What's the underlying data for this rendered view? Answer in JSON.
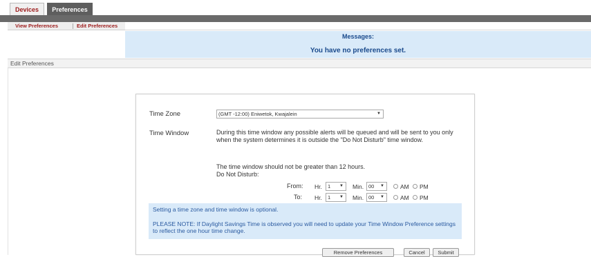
{
  "tabs": {
    "devices": "Devices",
    "preferences": "Preferences"
  },
  "sub_nav": {
    "view": "View Preferences",
    "edit": "Edit Preferences"
  },
  "messages": {
    "title": "Messages:",
    "text": "You have no preferences set."
  },
  "panel": {
    "title": "Edit Preferences"
  },
  "form": {
    "time_zone_label": "Time Zone",
    "time_zone_value": "(GMT -12:00) Eniwetok, Kwajalein",
    "time_window_label": "Time Window",
    "window_desc": "During this time window any possible alerts will be queued and will be sent to you only when the system determines it is outside the \"Do Not Disturb\" time window.",
    "window_limit": "The time window should not be greater than 12 hours.",
    "dnd_label": "Do Not Disturb:",
    "from_label": "From:",
    "to_label": "To:",
    "hr_label": "Hr.",
    "min_label": "Min.",
    "from_hr": "1",
    "from_min": "00",
    "to_hr": "1",
    "to_min": "00",
    "am_label": "AM",
    "pm_label": "PM"
  },
  "note": {
    "optional": "Setting a time zone and time window is optional.",
    "dst": "PLEASE NOTE: If Daylight Savings Time is observed you will need to update your Time Window Preference settings to reflect the one hour time change."
  },
  "buttons": {
    "remove": "Remove Preferences",
    "cancel": "Cancel",
    "submit": "Submit"
  },
  "colors": {
    "accent": "#9c1b1b",
    "info_bg": "#d9eaf9",
    "info_text": "#1a4a8c",
    "bar": "#6a6a6a"
  }
}
